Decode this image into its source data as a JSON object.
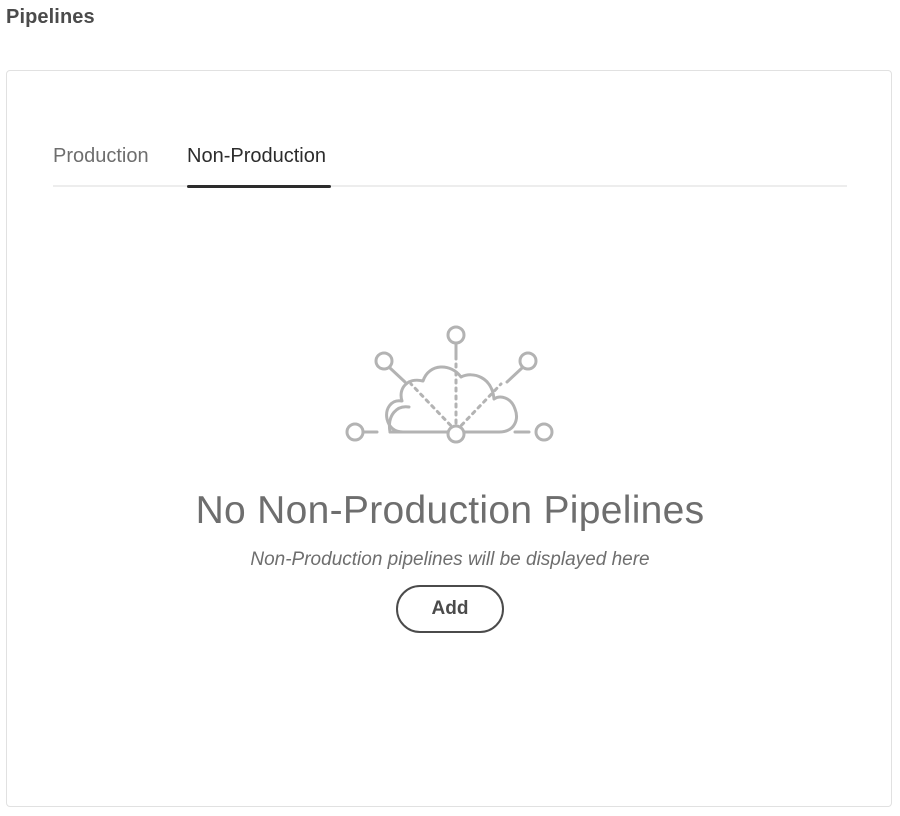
{
  "page": {
    "title": "Pipelines"
  },
  "tabs": [
    {
      "label": "Production",
      "selected": false
    },
    {
      "label": "Non-Production",
      "selected": true
    }
  ],
  "empty_state": {
    "icon": "cloud-network-icon",
    "heading": "No Non-Production Pipelines",
    "description": "Non-Production pipelines will be displayed here",
    "button_label": "Add"
  },
  "colors": {
    "text_primary": "#2c2c2c",
    "text_secondary": "#6e6e6e",
    "illustration": "#b3b3b3",
    "border": "#e1e1e1"
  }
}
